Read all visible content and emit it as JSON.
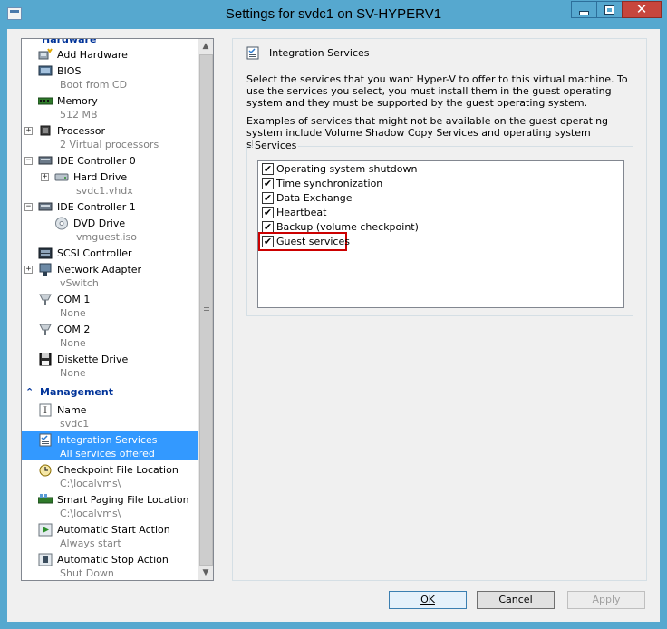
{
  "window": {
    "title": "Settings for svdc1 on SV-HYPERV1"
  },
  "tree": {
    "hardware_header": "Hardware",
    "items": [
      {
        "label": "Add Hardware",
        "sub": "",
        "icon": "add-hardware-icon"
      },
      {
        "label": "BIOS",
        "sub": "Boot from CD",
        "icon": "bios-icon"
      },
      {
        "label": "Memory",
        "sub": "512 MB",
        "icon": "memory-icon"
      },
      {
        "label": "Processor",
        "sub": "2 Virtual processors",
        "icon": "processor-icon"
      },
      {
        "label": "IDE Controller 0",
        "sub": "",
        "icon": "ide-controller-icon"
      },
      {
        "label": "Hard Drive",
        "sub": "svdc1.vhdx",
        "icon": "hard-drive-icon"
      },
      {
        "label": "IDE Controller 1",
        "sub": "",
        "icon": "ide-controller-icon"
      },
      {
        "label": "DVD Drive",
        "sub": "vmguest.iso",
        "icon": "dvd-drive-icon"
      },
      {
        "label": "SCSI Controller",
        "sub": "",
        "icon": "scsi-controller-icon"
      },
      {
        "label": "Network Adapter",
        "sub": "vSwitch",
        "icon": "network-adapter-icon"
      },
      {
        "label": "COM 1",
        "sub": "None",
        "icon": "com-port-icon"
      },
      {
        "label": "COM 2",
        "sub": "None",
        "icon": "com-port-icon"
      },
      {
        "label": "Diskette Drive",
        "sub": "None",
        "icon": "diskette-icon"
      }
    ],
    "management_header": "Management",
    "mgmt_items": [
      {
        "label": "Name",
        "sub": "svdc1",
        "icon": "name-icon"
      },
      {
        "label": "Integration Services",
        "sub": "All services offered",
        "icon": "integration-services-icon"
      },
      {
        "label": "Checkpoint File Location",
        "sub": "C:\\localvms\\",
        "icon": "checkpoint-icon"
      },
      {
        "label": "Smart Paging File Location",
        "sub": "C:\\localvms\\",
        "icon": "smart-paging-icon"
      },
      {
        "label": "Automatic Start Action",
        "sub": "Always start",
        "icon": "start-action-icon"
      },
      {
        "label": "Automatic Stop Action",
        "sub": "Shut Down",
        "icon": "stop-action-icon"
      }
    ]
  },
  "panel": {
    "heading": "Integration Services",
    "desc1": "Select the services that you want Hyper-V to offer to this virtual machine. To use the services you select, you must install them in the guest operating system and they must be supported by the guest operating system.",
    "desc2": "Examples of services that might not be available on the guest operating system include Volume Shadow Copy Services and operating system shutdown.",
    "group_title": "Services",
    "services": [
      {
        "label": "Operating system shutdown",
        "checked": true
      },
      {
        "label": "Time synchronization",
        "checked": true
      },
      {
        "label": "Data Exchange",
        "checked": true
      },
      {
        "label": "Heartbeat",
        "checked": true
      },
      {
        "label": "Backup (volume checkpoint)",
        "checked": true
      },
      {
        "label": "Guest services",
        "checked": true
      }
    ],
    "check_glyph": "✔"
  },
  "buttons": {
    "ok": "OK",
    "cancel": "Cancel",
    "apply": "Apply"
  },
  "colors": {
    "selection": "#3399ff",
    "highlight_box": "#cc0000",
    "section_header": "#003399"
  }
}
